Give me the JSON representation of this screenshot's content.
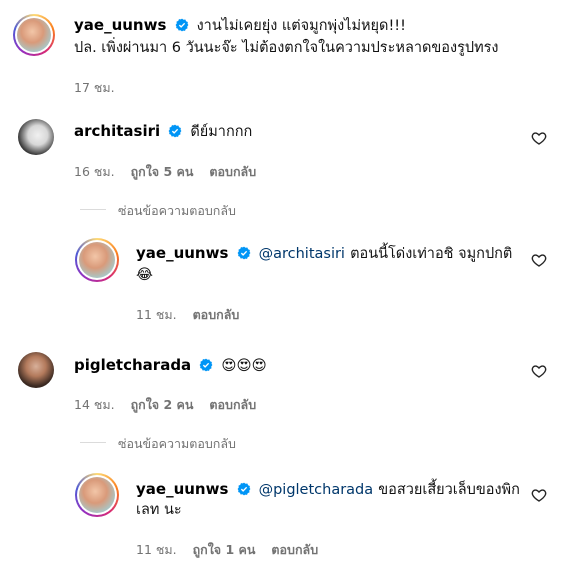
{
  "post": {
    "username": "yae_uunws",
    "caption_line1": "งานไม่เคยยุ่ง แต่จมูกพุ่งไม่หยุด!!!",
    "caption_line2": "ปล. เพิ่งผ่านมา 6 วันนะจ๊ะ ไม่ต้องตกใจในความประหลาดของรูปทรง",
    "time": "17 ชม."
  },
  "comments": [
    {
      "username": "architasiri",
      "text": "ดีย์มากกก",
      "time": "16 ชม.",
      "likes": "ถูกใจ 5 คน",
      "reply": "ตอบกลับ",
      "hide_replies": "ซ่อนข้อความตอบกลับ",
      "replies": [
        {
          "username": "yae_uunws",
          "mention": "@architasiri",
          "text": "ตอนนี้โด่งเท่าอชิ จมูกปกติ",
          "emoji": "😂",
          "time": "11 ชม.",
          "reply": "ตอบกลับ"
        }
      ]
    },
    {
      "username": "pigletcharada",
      "emoji": "😍😍😍",
      "time": "14 ชม.",
      "likes": "ถูกใจ 2 คน",
      "reply": "ตอบกลับ",
      "hide_replies": "ซ่อนข้อความตอบกลับ",
      "replies": [
        {
          "username": "yae_uunws",
          "mention": "@pigletcharada",
          "text_line1": "ขอสวยเสี้ยวเล็บของพิก",
          "text_line2": "เลท นะ",
          "time": "11 ชม.",
          "likes": "ถูกใจ 1 คน",
          "reply": "ตอบกลับ"
        }
      ]
    }
  ],
  "colors": {
    "verified": "#0095f6",
    "meta": "#737373",
    "mention": "#00376b"
  },
  "icons": [
    "verified-icon",
    "heart-icon",
    "avatar"
  ]
}
